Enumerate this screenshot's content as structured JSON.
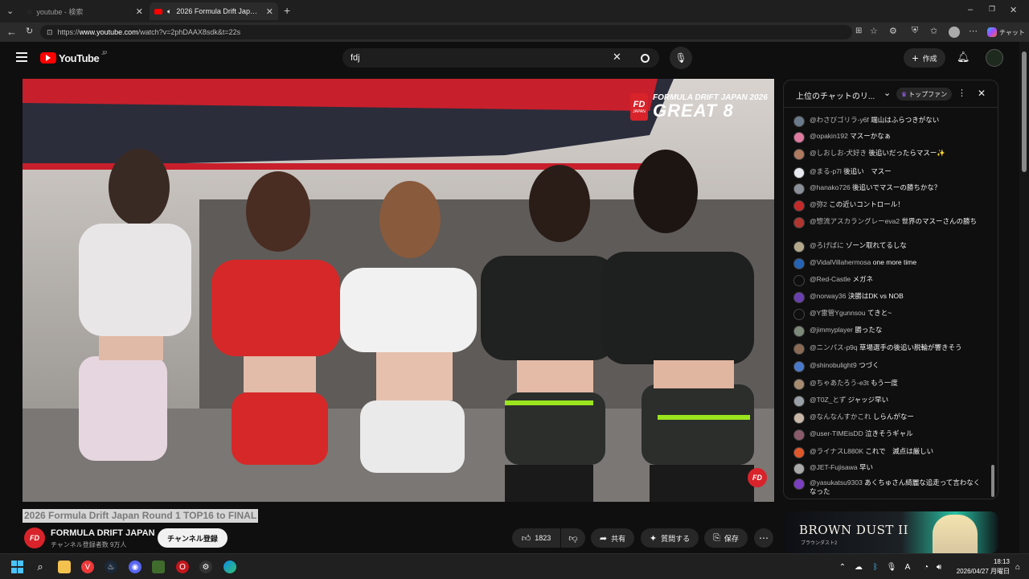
{
  "browser": {
    "tabs": [
      {
        "title": "youtube - 検索"
      },
      {
        "title": "2026 Formula Drift Japan Round 1 TOP16 to FINAL"
      }
    ],
    "url_prefix": "https://",
    "url_host": "www.youtube.com",
    "url_path": "/watch?v=2phDAAX8sdk&t=22s",
    "copilot_label": "チャット"
  },
  "youtube": {
    "logo_text": "YouTube",
    "logo_region": "JP",
    "search_value": "fdj",
    "create_label": "作成",
    "video_title": "2026 Formula Drift Japan Round 1 TOP16 to FINAL",
    "overlay_top": "FORMULA DRIFT JAPAN 2026",
    "overlay_main": "GREAT 8",
    "fd_badge": "FD",
    "fd_badge_sub": "JAPAN",
    "channel_name": "FORMULA DRIFT JAPAN",
    "subscribers": "チャンネル登録者数 9万人",
    "subscribe_label": "チャンネル登録",
    "like_count": "1823",
    "share_label": "共有",
    "ask_label": "質問する",
    "save_label": "保存"
  },
  "chat": {
    "header": "上位のチャットのリ...",
    "filter_label": "トップファン",
    "messages": [
      {
        "author": "@わさびゴリラ-y6f",
        "text": "端山はふらつきがない",
        "color": "#6b7a8a"
      },
      {
        "author": "@opakin192",
        "text": "マスーかなぁ",
        "color": "#e07aa0"
      },
      {
        "author": "@しおしお-犬好き",
        "text": "後追いだったらマスー✨",
        "color": "#b07a60"
      },
      {
        "author": "@まる-p7l",
        "text": "後追い　マスー",
        "color": "#e8e8f0"
      },
      {
        "author": "@hanako726",
        "text": "後追いでマスーの勝ちかな？",
        "color": "#8a8f99"
      },
      {
        "author": "@弥2",
        "text": "この近いコントロール！",
        "color": "#c42a2a"
      },
      {
        "author": "@惣流アスカラングレーeva2",
        "text": "世界のマスーさんの勝ち",
        "color": "#b0352f"
      },
      {
        "author": "@ろげばに",
        "text": "ゾーン取れてるしな",
        "color": "#b3a98a"
      },
      {
        "author": "@VidalVillahermosa",
        "text": "one more time",
        "color": "#2563b5"
      },
      {
        "author": "@Red-Castle",
        "text": "メガネ",
        "color": "#0f0f0f"
      },
      {
        "author": "@norway36",
        "text": "決勝はDK vs NOB",
        "color": "#6a3fb0"
      },
      {
        "author": "@Y雷管Ygunnsou",
        "text": "てきと~",
        "color": "#0f0f0f"
      },
      {
        "author": "@jimmyplayer",
        "text": "勝ったな",
        "color": "#7d8a7a"
      },
      {
        "author": "@ニンパス-p9q",
        "text": "草場選手の後追い脱輪が響きそう",
        "color": "#8a6a55"
      },
      {
        "author": "@shinobulight9",
        "text": "つづく",
        "color": "#4a79c9"
      },
      {
        "author": "@ちゃあたろう-e3t",
        "text": "もう一度",
        "color": "#a88c70"
      },
      {
        "author": "@T0Z_とず",
        "text": "ジャッジ早い",
        "color": "#9aa0a8"
      },
      {
        "author": "@なんなんすかこれ",
        "text": "しらんがなー",
        "color": "#c9b8a8"
      },
      {
        "author": "@user-TIMEisDD",
        "text": "泣きそうギャル",
        "color": "#8a5a6a"
      },
      {
        "author": "@ライナスL880K",
        "text": "これで　滅点は厳しい",
        "color": "#e0572a"
      },
      {
        "author": "@JET-Fujisawa",
        "text": "早い",
        "color": "#aaaaaa"
      },
      {
        "author": "@yasukatsu9303",
        "text": "あくちゅさん綺麗な追走って言わなくなった",
        "color": "#7a3fc0"
      }
    ]
  },
  "ad": {
    "title": "BROWN DUST II",
    "subtitle": "ブラウンダスト2"
  },
  "taskbar": {
    "time": "18:13",
    "date": "2026/04/27 月曜日"
  }
}
